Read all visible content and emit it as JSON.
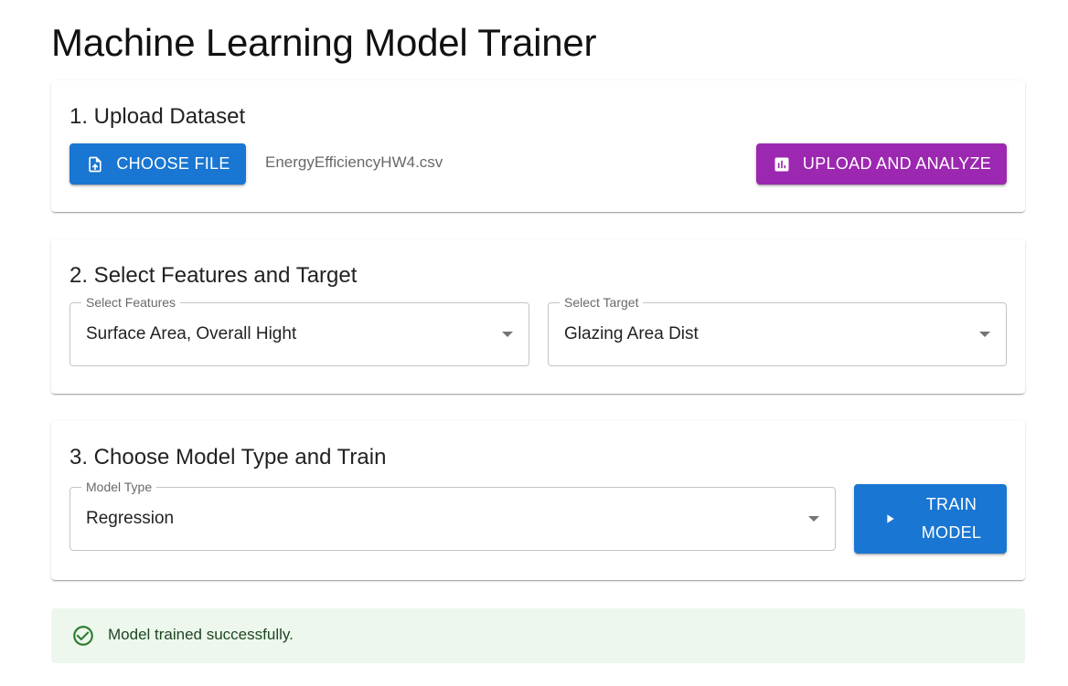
{
  "page": {
    "title": "Machine Learning Model Trainer"
  },
  "upload": {
    "title": "1. Upload Dataset",
    "choose_file_label": "CHOOSE FILE",
    "choose_file_icon": "upload-file-icon",
    "file_name": "EnergyEfficiencyHW4.csv",
    "upload_analyze_label": "UPLOAD AND ANALYZE",
    "upload_analyze_icon": "bar-chart-icon"
  },
  "features": {
    "title": "2. Select Features and Target",
    "features_label": "Select Features",
    "features_value": "Surface Area, Overall Hight",
    "target_label": "Select Target",
    "target_value": "Glazing Area Dist"
  },
  "model": {
    "title": "3. Choose Model Type and Train",
    "type_label": "Model Type",
    "type_value": "Regression",
    "train_label_line1": "TRAIN",
    "train_label_line2": "MODEL",
    "train_icon": "play-icon"
  },
  "alert": {
    "message": "Model trained successfully.",
    "icon": "check-circle-icon"
  },
  "colors": {
    "primary": "#1976d2",
    "secondary": "#9c27b0",
    "success_bg": "#edf7ed",
    "success_icon": "#2e7d32",
    "success_text": "#1e4620"
  }
}
